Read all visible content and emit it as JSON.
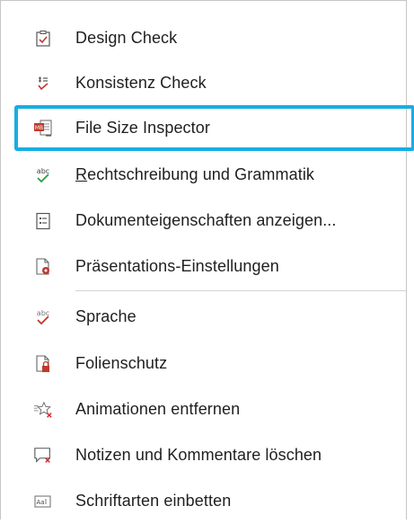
{
  "menu": {
    "items": [
      {
        "label": "Design Check",
        "icon": "checkbox-clipboard-icon"
      },
      {
        "label": "Konsistenz Check",
        "icon": "check-lines-icon"
      },
      {
        "label": "File Size Inspector",
        "icon": "file-size-icon",
        "highlighted": true
      },
      {
        "label_underlined": "R",
        "label": "echtschreibung und Grammatik",
        "icon": "spelling-abc-icon"
      },
      {
        "label": "Dokumenteigenschaften anzeigen...",
        "icon": "document-properties-icon"
      },
      {
        "label": "Präsentations-Einstellungen",
        "icon": "presentation-settings-icon"
      },
      {
        "label": "Sprache",
        "icon": "language-abc-icon"
      },
      {
        "label": "Folienschutz",
        "icon": "slide-lock-icon"
      },
      {
        "label": "Animationen entfernen",
        "icon": "remove-animation-icon"
      },
      {
        "label": "Notizen und Kommentare löschen",
        "icon": "delete-comments-icon"
      },
      {
        "label": "Schriftarten einbetten",
        "icon": "embed-fonts-icon"
      }
    ]
  },
  "colors": {
    "highlight_border": "#17aee3",
    "check_red": "#c0392b",
    "check_green": "#2e9e44",
    "separator": "#d4d4d4"
  }
}
